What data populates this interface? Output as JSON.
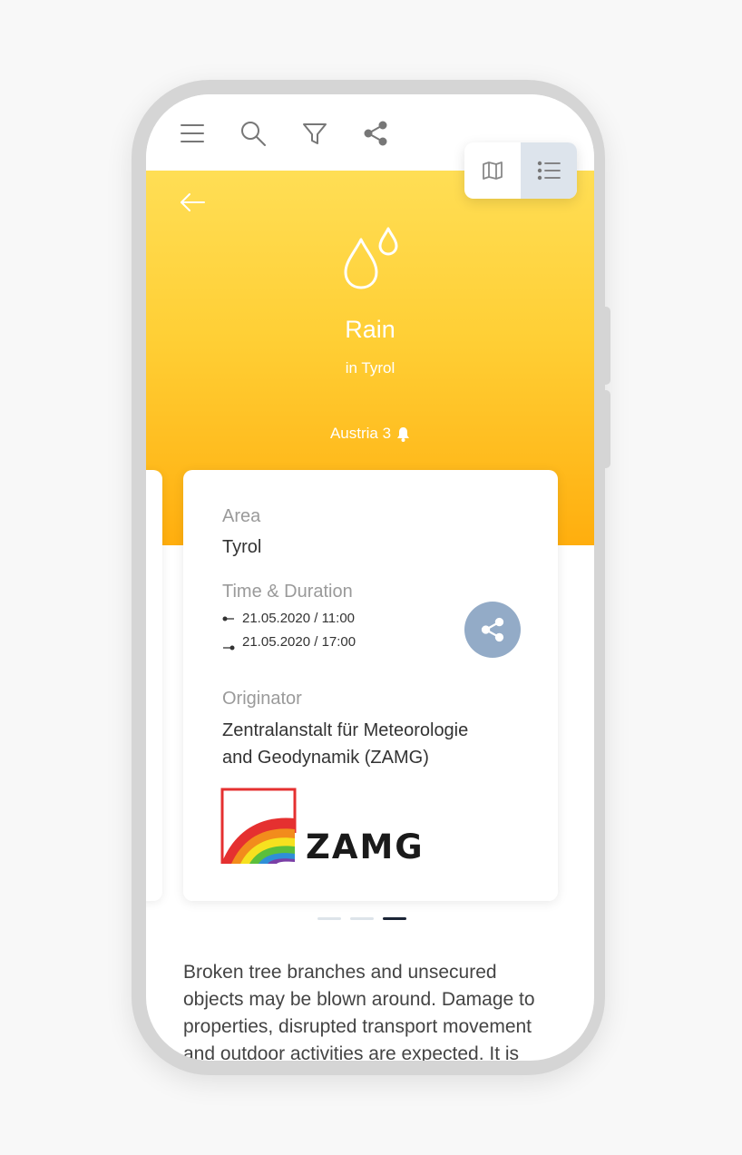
{
  "toolbar": {
    "icons": [
      "menu-icon",
      "search-icon",
      "filter-icon",
      "share-icon"
    ],
    "view_toggle": {
      "options": [
        "map-icon",
        "list-icon"
      ],
      "active": "list-icon"
    }
  },
  "hero": {
    "icon": "rain-drops-icon",
    "title": "Rain",
    "subtitle": "in Tyrol",
    "location_label": "Austria 3",
    "location_icon": "bell-icon",
    "gradient_top": "#ffde55",
    "gradient_bottom": "#ffae0e"
  },
  "card": {
    "area_label": "Area",
    "area_value": "Tyrol",
    "time_label": "Time & Duration",
    "start_time": "21.05.2020 / 11:00",
    "end_time": "21.05.2020 / 17:00",
    "originator_label": "Originator",
    "originator_line1": "Zentralanstalt für Meteorologie",
    "originator_line2": "and Geodynamik (ZAMG)",
    "logo_text": "ZAMG",
    "share_color": "#93abc7"
  },
  "pager": {
    "count": 3,
    "active_index": 2
  },
  "description": {
    "line1": "Broken tree branches and unsecured",
    "line2": "objects may be blown around. Damage to",
    "line3": "properties, disrupted transport movement",
    "line4": "and outdoor activities are expected. It is"
  }
}
